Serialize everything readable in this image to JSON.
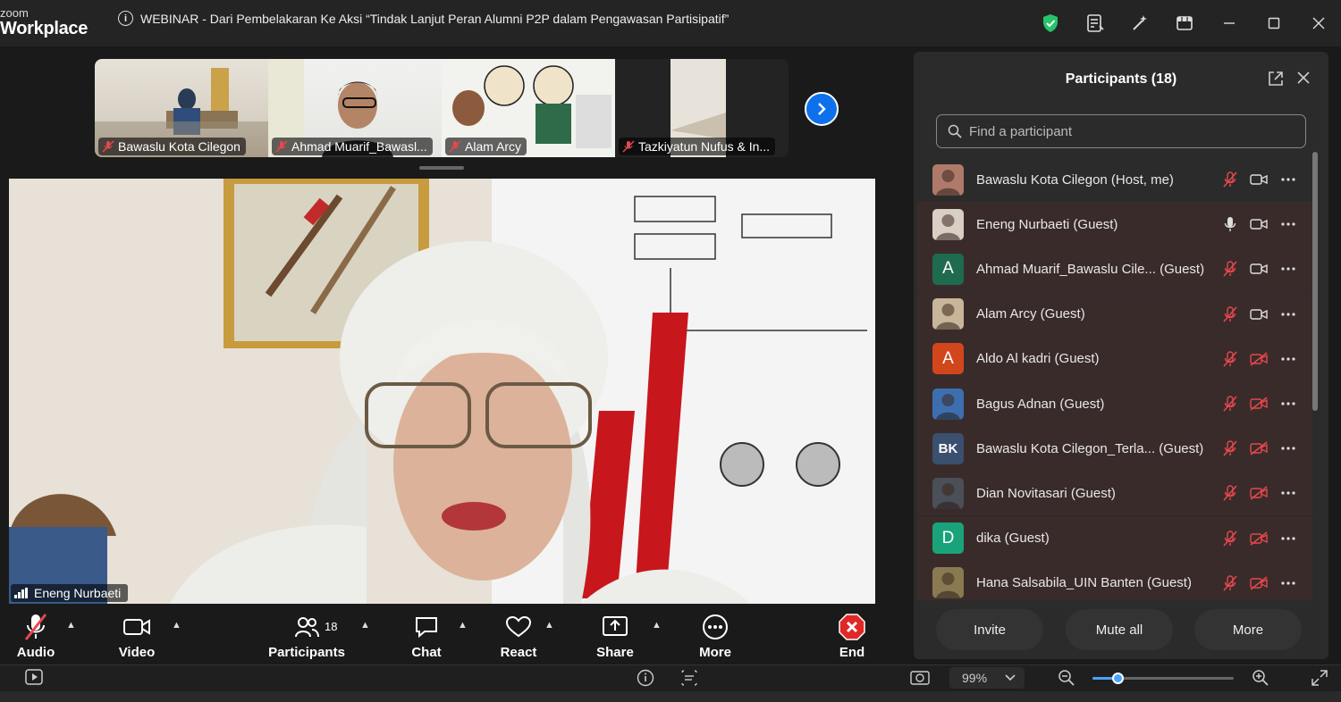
{
  "app": {
    "logo_line1": "zoom",
    "logo_line2": "Workplace"
  },
  "title": "WEBINAR - Dari Pembelakaran Ke Aksi “Tindak Lanjut Peran Alumni P2P dalam Pengawasan Partisipatif”",
  "strip": {
    "thumbnails": [
      {
        "name": "Bawaslu Kota Cilegon",
        "muted": true
      },
      {
        "name": "Ahmad Muarif_Bawasl...",
        "muted": true
      },
      {
        "name": "Alam Arcy",
        "muted": true
      },
      {
        "name": "Tazkiyatun Nufus & In...",
        "muted": true
      }
    ]
  },
  "main_video": {
    "name": "Eneng Nurbaeti"
  },
  "controls": {
    "audio": "Audio",
    "video": "Video",
    "participants": "Participants",
    "participants_count": "18",
    "chat": "Chat",
    "react": "React",
    "share": "Share",
    "more": "More",
    "end": "End"
  },
  "statusbar": {
    "zoom": "99%",
    "zoom_level": 0.18
  },
  "panel": {
    "title": "Participants (18)",
    "search_placeholder": "Find a participant",
    "participants": [
      {
        "name": "Bawaslu Kota Cilegon (Host, me)",
        "avatar": "",
        "avatar_color": "#b07a6a",
        "mic": "muted",
        "cam": "on"
      },
      {
        "name": "Eneng Nurbaeti (Guest)",
        "avatar": "",
        "avatar_color": "#d9cfc4",
        "mic": "on",
        "cam": "on"
      },
      {
        "name": "Ahmad Muarif_Bawaslu Cile...  (Guest)",
        "avatar": "A",
        "avatar_color": "#1f6b4f",
        "mic": "muted",
        "cam": "on"
      },
      {
        "name": "Alam Arcy (Guest)",
        "avatar": "",
        "avatar_color": "#c9b59a",
        "mic": "muted",
        "cam": "on"
      },
      {
        "name": "Aldo Al kadri (Guest)",
        "avatar": "A",
        "avatar_color": "#d2461c",
        "mic": "muted",
        "cam": "off"
      },
      {
        "name": "Bagus Adnan (Guest)",
        "avatar": "",
        "avatar_color": "#3d6fb0",
        "mic": "muted",
        "cam": "off"
      },
      {
        "name": "Bawaslu Kota Cilegon_Terla...  (Guest)",
        "avatar": "BK",
        "avatar_color": "#3b4f6e",
        "mic": "muted",
        "cam": "off"
      },
      {
        "name": "Dian Novitasari (Guest)",
        "avatar": "",
        "avatar_color": "#4a4f58",
        "mic": "muted",
        "cam": "off"
      },
      {
        "name": "dika (Guest)",
        "avatar": "D",
        "avatar_color": "#1aa37a",
        "mic": "muted",
        "cam": "off"
      },
      {
        "name": "Hana Salsabila_UIN Banten (Guest)",
        "avatar": "",
        "avatar_color": "#8a7a52",
        "mic": "muted",
        "cam": "off"
      }
    ],
    "buttons": {
      "invite": "Invite",
      "mute_all": "Mute all",
      "more": "More"
    }
  },
  "colors": {
    "accent": "#0e71eb",
    "muted_red": "#e5484d",
    "end_red": "#e02828",
    "shield_green": "#27c46a"
  }
}
